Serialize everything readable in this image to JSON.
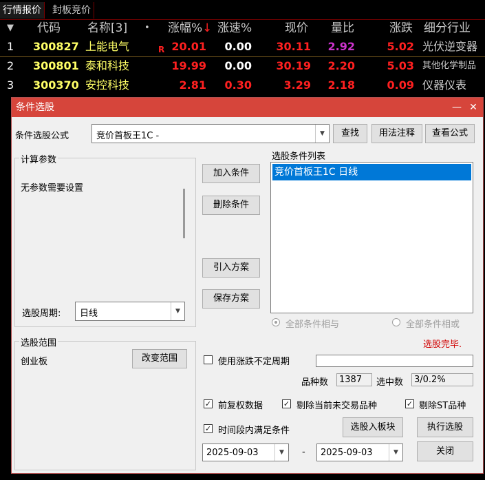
{
  "tabs": [
    "行情报价",
    "封板竞价"
  ],
  "table": {
    "headers": {
      "menu": "▼",
      "code": "代码",
      "name": "名称[3]",
      "dot": "•",
      "change_pct": "涨幅%",
      "sort_arrow": "↓",
      "speed": "涨速%",
      "price": "现价",
      "volume_ratio": "量比",
      "change": "涨跌",
      "industry": "细分行业"
    },
    "rows": [
      {
        "index": "1",
        "code": "300827",
        "name": "上能电气",
        "flag": "R",
        "change_pct": "20.01",
        "speed": "0.00",
        "price": "30.11",
        "volume_ratio": "2.92",
        "change": "5.02",
        "industry": "光伏逆变器"
      },
      {
        "index": "2",
        "code": "300801",
        "name": "泰和科技",
        "flag": "",
        "change_pct": "19.99",
        "speed": "0.00",
        "price": "30.19",
        "volume_ratio": "2.20",
        "change": "5.03",
        "industry": "其他化学制品"
      },
      {
        "index": "3",
        "code": "300370",
        "name": "安控科技",
        "flag": "",
        "change_pct": "2.81",
        "speed": "0.30",
        "price": "3.29",
        "volume_ratio": "2.18",
        "change": "0.09",
        "industry": "仪器仪表"
      }
    ]
  },
  "dialog": {
    "title": "条件选股",
    "minimize": "—",
    "close": "✕",
    "formula_label": "条件选股公式",
    "formula_value": "竞价首板王1C  -",
    "find_button": "查找",
    "usage_button": "用法注释",
    "view_formula_button": "查看公式",
    "params_group": "计算参数",
    "params_text": "无参数需要设置",
    "period_label": "选股周期:",
    "period_value": "日线",
    "add_condition": "加入条件",
    "delete_condition": "删除条件",
    "import_plan": "引入方案",
    "save_plan": "保存方案",
    "conditions_list_label": "选股条件列表",
    "conditions": [
      "竞价首板王1C  日线"
    ],
    "radio_and": "全部条件相与",
    "radio_or": "全部条件相或",
    "status": "选股完毕.",
    "range_group": "选股范围",
    "range_value": "创业板",
    "change_range": "改变范围",
    "use_variable_period": "使用涨跌不定周期",
    "variety_count_label": "品种数",
    "variety_count": "1387",
    "selected_count_label": "选中数",
    "selected_count": "3/0.2%",
    "forward_adjust": "前复权数据",
    "remove_untraded": "剔除当前未交易品种",
    "remove_st": "剔除ST品种",
    "period_satisfy": "时间段内满足条件",
    "add_to_block": "选股入板块",
    "execute": "执行选股",
    "start_date": "2025-09-03",
    "date_sep": "-",
    "end_date": "2025-09-03",
    "close_button": "关闭"
  },
  "colors": {
    "rise": "#ff2020",
    "code": "#ffff66",
    "name": "#ffff66",
    "volume_high": "#cc33cc",
    "titlebar": "#d6453b",
    "selection": "#0078d7",
    "status": "#d00000"
  }
}
